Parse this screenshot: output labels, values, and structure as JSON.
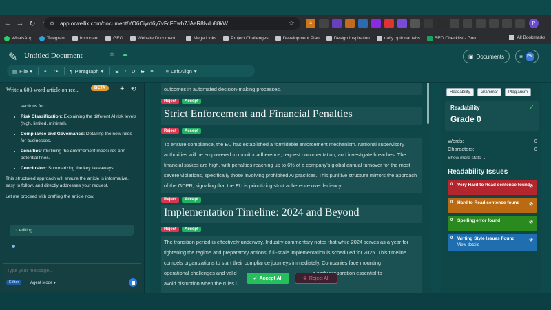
{
  "browser": {
    "url": "app.orwellix.com/document/YO6Ciyrd6y7vFcFEwh7JAeR8Ndu88kW",
    "bookmarks": [
      "WhatsApp",
      "Telegram",
      "Important",
      "GEO",
      "Website Document...",
      "Mega Links",
      "Project Challenges",
      "Development Plan",
      "Design Inspiration",
      "daily optional tabs",
      "SEO Checklist - Goo...",
      "All Bookmarks"
    ],
    "profile_initial": "P"
  },
  "app": {
    "doc_title": "Untitled Document",
    "documents_label": "Documents",
    "avatar_initials": "PM",
    "toolbar": {
      "file": "File",
      "paragraph": "Paragraph",
      "bold": "B",
      "italic": "I",
      "underline": "U",
      "strike": "S",
      "align": "Left Align"
    }
  },
  "chat": {
    "title": "Write a 600-word article on rec...",
    "beta": "BETA",
    "intro": "sections for:",
    "items": [
      {
        "bold": "Risk Classification:",
        "text": " Explaining the different AI risk levels (high, limited, minimal)."
      },
      {
        "bold": "Compliance and Governance:",
        "text": " Detailing the new rules for businesses."
      },
      {
        "bold": "Penalties:",
        "text": " Outlining the enforcement measures and potential fines."
      },
      {
        "bold": "Conclusion:",
        "text": " Summarizing the key takeaways."
      }
    ],
    "para1": "This structured approach will ensure the article is informative, easy to follow, and directly addresses your request.",
    "para2": "Let me proceed with drafting the article now.",
    "status": "editing...",
    "input_placeholder": "Type your message...",
    "editor_tag": "Editor",
    "agent_mode": "Agent Mode"
  },
  "editor": {
    "top_text": "outcomes in automated decision-making processes.",
    "reject": "Reject",
    "accept": "Accept",
    "heading1": "Strict Enforcement and Financial Penalties",
    "para1": "To ensure compliance, the EU has established a formidable enforcement mechanism. National supervisory authorities will be empowered to monitor adherence, request documentation, and investigate breaches. The financial stakes are high, with penalties reaching up to 6% of a company's global annual turnover for the most severe violations, specifically those involving prohibited AI practices. This punitive structure mirrors the approach of the GDPR, signaling that the EU is prioritizing strict adherence over leniency.",
    "heading2": "Implementation Timeline: 2024 and Beyond",
    "para2_a": "The transition period is effectively underway. Industry commentary notes that while 2024 serves as a year for tightening the regime and preparatory actions, full-scale implementation is scheduled for 2025. This timeline compels organizations to start their compliance journeys immediately. Companies face mounting",
    "para2_b": "operational challenges and valid",
    "para2_c": "g early preparation essential to",
    "para2_d": "avoid disruption when the rules l",
    "accept_all": "Accept All",
    "reject_all": "Reject All"
  },
  "panel": {
    "tabs": [
      "Readability",
      "Grammar",
      "Plagiarism"
    ],
    "readability_label": "Readability",
    "grade": "Grade 0",
    "words_label": "Words:",
    "words": "0",
    "chars_label": "Characters:",
    "chars": "0",
    "more_stats": "Show more stats",
    "issues_title": "Readability Issues",
    "issues": [
      {
        "num": "0",
        "label": "Very Hard to Read sentence found",
        "color": "#b3262e"
      },
      {
        "num": "0",
        "label": "Hard to Read sentence found",
        "color": "#b96a12"
      },
      {
        "num": "0",
        "label": "Spelling error found",
        "color": "#2b8a1f"
      },
      {
        "num": "0",
        "label": "Writing Style Issues Found",
        "color": "#1f6fb0",
        "sub": "View details"
      }
    ]
  }
}
